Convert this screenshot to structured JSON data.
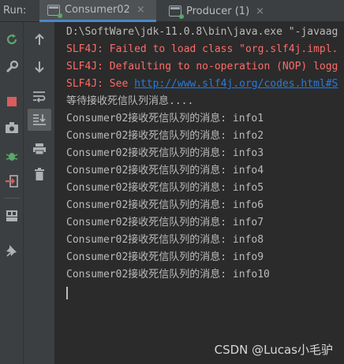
{
  "run": {
    "label": "Run:"
  },
  "tabs": [
    {
      "label": "Consumer02",
      "close": "×"
    },
    {
      "label": "Producer (1)",
      "close": "×"
    }
  ],
  "console": {
    "lines": [
      {
        "text": "D:\\SoftWare\\jdk-11.0.8\\bin\\java.exe \"-javaag",
        "kind": "plain"
      },
      {
        "text": "SLF4J: Failed to load class \"org.slf4j.impl.",
        "kind": "err"
      },
      {
        "text": "SLF4J: Defaulting to no-operation (NOP) logg",
        "kind": "err"
      },
      {
        "prefix": "SLF4J: See ",
        "link": "http://www.slf4j.org/codes.html#S",
        "kind": "link"
      },
      {
        "text": "等待接收死信队列消息....",
        "kind": "plain"
      },
      {
        "text": "Consumer02接收死信队列的消息: info1",
        "kind": "plain"
      },
      {
        "text": "Consumer02接收死信队列的消息: info2",
        "kind": "plain"
      },
      {
        "text": "Consumer02接收死信队列的消息: info3",
        "kind": "plain"
      },
      {
        "text": "Consumer02接收死信队列的消息: info4",
        "kind": "plain"
      },
      {
        "text": "Consumer02接收死信队列的消息: info5",
        "kind": "plain"
      },
      {
        "text": "Consumer02接收死信队列的消息: info6",
        "kind": "plain"
      },
      {
        "text": "Consumer02接收死信队列的消息: info7",
        "kind": "plain"
      },
      {
        "text": "Consumer02接收死信队列的消息: info8",
        "kind": "plain"
      },
      {
        "text": "Consumer02接收死信队列的消息: info9",
        "kind": "plain"
      },
      {
        "text": "Consumer02接收死信队列的消息: info10",
        "kind": "plain"
      }
    ]
  },
  "toolbar_left": [
    {
      "icon": "rerun-icon",
      "glyph": "↻",
      "color": "#59a869"
    },
    {
      "icon": "wrench-icon",
      "glyph": "🔧",
      "color": "#afb1b3"
    },
    {
      "icon": "stop-icon",
      "glyph": "■",
      "color": "#db5c5c"
    },
    {
      "icon": "camera-icon",
      "glyph": "📷",
      "color": "#afb1b3"
    },
    {
      "icon": "bug-icon",
      "glyph": "✱",
      "color": "#59a869"
    },
    {
      "icon": "exit-icon",
      "glyph": "⇥",
      "color": "#db5c5c"
    },
    {
      "icon": "layout-icon",
      "glyph": "▦",
      "color": "#afb1b3"
    },
    {
      "icon": "pin-icon",
      "glyph": "📌",
      "color": "#afb1b3"
    }
  ],
  "toolbar_right": [
    {
      "icon": "arrow-up-icon",
      "glyph": "↑"
    },
    {
      "icon": "arrow-down-icon",
      "glyph": "↓"
    },
    {
      "icon": "soft-wrap-icon",
      "glyph": "↩"
    },
    {
      "icon": "scroll-to-end-icon",
      "glyph": "⤓"
    },
    {
      "icon": "print-icon",
      "glyph": "⎙"
    },
    {
      "icon": "trash-icon",
      "glyph": "🗑"
    }
  ],
  "watermark": "CSDN @Lucas小毛驴",
  "colors": {
    "accent": "#4a88c7",
    "error": "#ff6b68",
    "link": "#287bde",
    "text": "#bbbbbb"
  }
}
